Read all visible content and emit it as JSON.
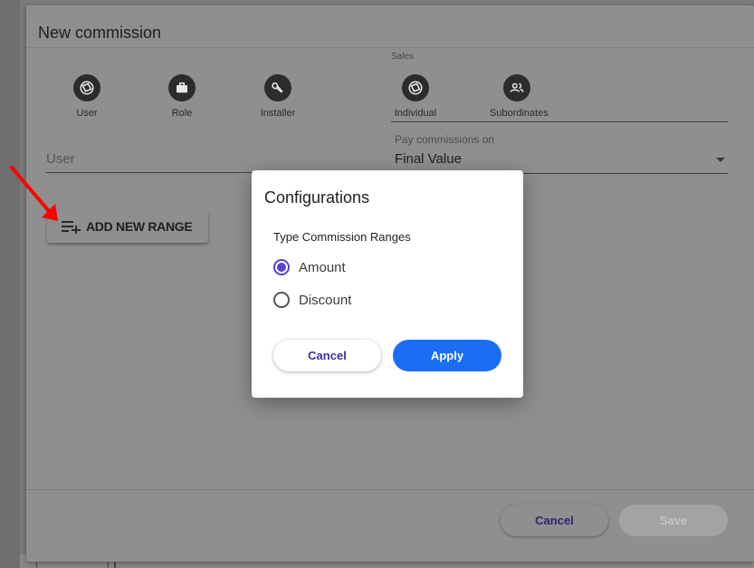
{
  "dialog": {
    "title": "New commission",
    "assign_options": [
      {
        "label": "User",
        "icon": "user-badge-icon"
      },
      {
        "label": "Role",
        "icon": "briefcase-icon"
      },
      {
        "label": "Installer",
        "icon": "wrench-icon"
      }
    ],
    "sales": {
      "label": "Sales",
      "options": [
        {
          "label": "Individual",
          "icon": "user-badge-icon"
        },
        {
          "label": "Subordinates",
          "icon": "group-icon"
        }
      ]
    },
    "user_field": {
      "placeholder": "User",
      "value": ""
    },
    "pay_commissions": {
      "label": "Pay commissions on",
      "value": "Final Value"
    },
    "add_range_label": "ADD NEW RANGE",
    "footer": {
      "cancel_label": "Cancel",
      "save_label": "Save"
    }
  },
  "modal": {
    "title": "Configurations",
    "subtitle": "Type Commission Ranges",
    "options": [
      {
        "label": "Amount",
        "checked": true
      },
      {
        "label": "Discount",
        "checked": false
      }
    ],
    "cancel_label": "Cancel",
    "apply_label": "Apply"
  },
  "colors": {
    "accent": "#5b3fd6",
    "apply_button": "#1a6ef5",
    "annotation_arrow": "#ff0000"
  }
}
